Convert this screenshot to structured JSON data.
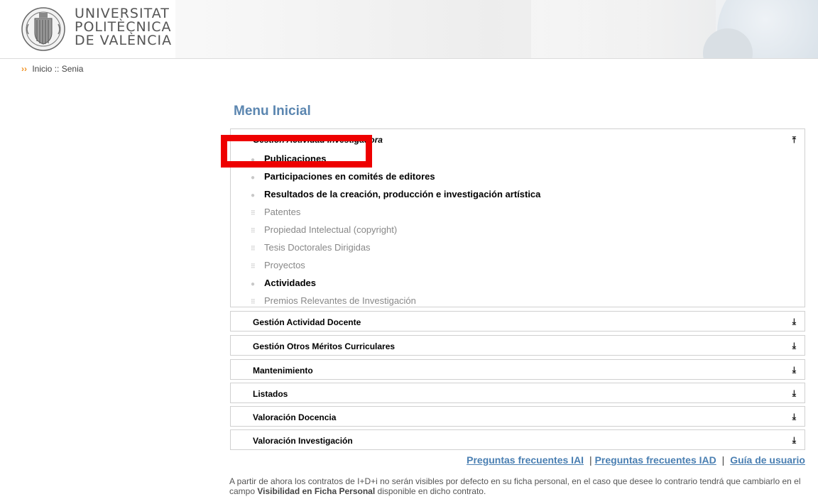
{
  "header": {
    "logo_lines": [
      "UNIVERSITAT",
      "POLITÈCNICA",
      "DE VALÈNCIA"
    ],
    "seal_icon": "upv-seal-icon"
  },
  "breadcrumb": {
    "arrows": "››",
    "home": "Inicio",
    "separator": "::",
    "current": "Senia"
  },
  "menu": {
    "title": "Menu Inicial",
    "open_section": {
      "label": "Gestión Actividad Investigadora",
      "toggle_icon": "chevron-double-up-icon",
      "items": [
        {
          "label": "Publicaciones",
          "enabled": true
        },
        {
          "label": "Participaciones en comités de editores",
          "enabled": true
        },
        {
          "label": "Resultados de la creación, producción e investigación artística",
          "enabled": true
        },
        {
          "label": "Patentes",
          "enabled": false
        },
        {
          "label": "Propiedad Intelectual (copyright)",
          "enabled": false
        },
        {
          "label": "Tesis Doctorales Dirigidas",
          "enabled": false
        },
        {
          "label": "Proyectos",
          "enabled": false
        },
        {
          "label": "Actividades",
          "enabled": true
        },
        {
          "label": "Premios Relevantes de Investigación",
          "enabled": false
        }
      ]
    },
    "closed_sections": [
      {
        "label": "Gestión Actividad Docente"
      },
      {
        "label": "Gestión Otros Méritos Curriculares"
      },
      {
        "label": "Mantenimiento"
      },
      {
        "label": "Listados"
      },
      {
        "label": "Valoración Docencia"
      },
      {
        "label": "Valoración Investigación"
      }
    ],
    "closed_toggle_icon": "chevron-double-down-icon"
  },
  "footer": {
    "faq_iai": "Preguntas frecuentes IAI",
    "faq_iad": "Preguntas frecuentes IAD",
    "guide": "Guía de usuario",
    "separator": "|",
    "notice_before": "A partir de ahora los contratos de I+D+i no serán visibles por defecto en su ficha personal, en el caso que desee lo contrario tendrá que cambiarlo en el campo ",
    "notice_bold": "Visibilidad en Ficha Personal",
    "notice_after": " disponible en dicho contrato."
  },
  "colors": {
    "title": "#5b86b0",
    "link": "#4a7fb2",
    "highlight": "#ee0000",
    "breadcrumb_arrows": "#f09020"
  }
}
